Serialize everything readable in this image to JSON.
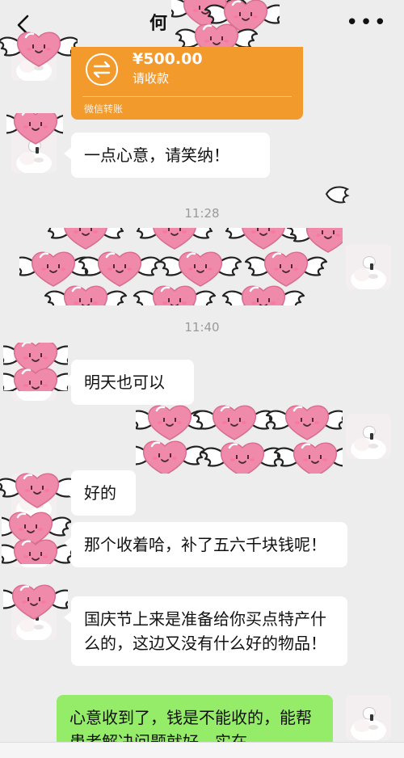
{
  "header": {
    "title": "何",
    "more": "•••"
  },
  "transfer": {
    "amount": "¥500.00",
    "action": "请收款",
    "footer": "微信转账"
  },
  "messages": {
    "m1": "一点心意，请笑纳！",
    "m2": "明天也可以",
    "m3": "好的",
    "m4": "那个收着哈，补了五六千块钱呢！",
    "m5": "国庆节上来是准备给你买点特产什么的，这边又没有什么好的物品！",
    "m6": "心意收到了，钱是不能收的，能帮患者解决问题就好。实在"
  },
  "timestamps": {
    "t1": "11:28",
    "t2": "11:40"
  },
  "colors": {
    "bg": "#ededed",
    "transfer_orange": "#f39a2c",
    "my_bubble": "#95ec69",
    "heart": "#f08aaa"
  }
}
